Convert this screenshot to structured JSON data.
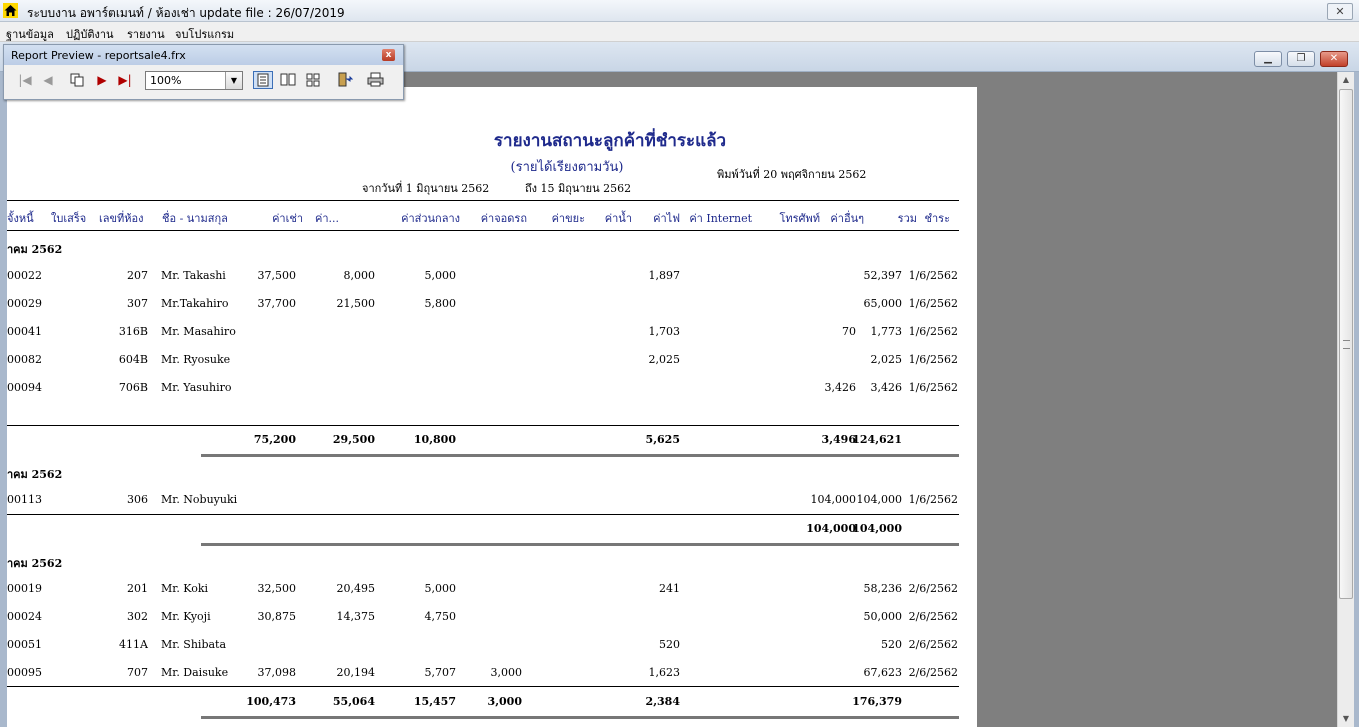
{
  "window": {
    "title": "ระบบงาน อพาร์ตเมนท์ / ห้องเช่า update file : 26/07/2019",
    "close_glyph": "✕"
  },
  "menu": [
    "ฐานข้อมูล",
    "ปฏิบัติงาน",
    "รายงาน",
    "จบโปรแกรม"
  ],
  "mdi_controls": {
    "minimize": "▁",
    "restore": "❐",
    "close": "✕"
  },
  "preview_toolbar": {
    "title": "Report Preview - reportsale4.frx",
    "zoom": "100%"
  },
  "report": {
    "title": "รายงานสถานะลูกค้าที่ชำระแล้ว",
    "subtitle": "(รายได้เรียงตามวัน)",
    "range_from": "จากวันที่  1 มิถุนายน 2562",
    "range_to": "ถึง   15 มิถุนายน 2562",
    "printed": "พิมพ์วันที่  20 พฤศจิกายน 2562",
    "columns": {
      "debt": "จั้งหนี้",
      "receipt": "ใบเสร็จ",
      "room": "เลขที่ห้อง",
      "name": "ชื่อ - นามสกุล",
      "rent": "ค่าเช่า",
      "c2": "ค่า...",
      "common": "ค่าส่วนกลาง",
      "parking": "ค่าจอดรถ",
      "garbage": "ค่าขยะ",
      "water": "ค่าน้ำ",
      "electric": "ค่าไฟ",
      "internet": "ค่า Internet",
      "phone": "โทรศัพท์",
      "other": "ค่าอื่นๆ",
      "total": "รวม",
      "paid": "ชำระ"
    },
    "groups": [
      {
        "header": "าคม  2562",
        "rows": [
          {
            "debt": "00022",
            "room": "207",
            "name": "Mr. Takashi",
            "rent": "37,500",
            "c2": "8,000",
            "common": "5,000",
            "parking": "",
            "electric": "1,897",
            "other": "",
            "total": "52,397",
            "paid": "1/6/2562"
          },
          {
            "debt": "00029",
            "room": "307",
            "name": "Mr.Takahiro",
            "rent": "37,700",
            "c2": "21,500",
            "common": "5,800",
            "parking": "",
            "electric": "",
            "other": "",
            "total": "65,000",
            "paid": "1/6/2562"
          },
          {
            "debt": "00041",
            "room": "316B",
            "name": "Mr. Masahiro",
            "rent": "",
            "c2": "",
            "common": "",
            "parking": "",
            "electric": "1,703",
            "other": "70",
            "total": "1,773",
            "paid": "1/6/2562"
          },
          {
            "debt": "00082",
            "room": "604B",
            "name": "Mr. Ryosuke",
            "rent": "",
            "c2": "",
            "common": "",
            "parking": "",
            "electric": "2,025",
            "other": "",
            "total": "2,025",
            "paid": "1/6/2562"
          },
          {
            "debt": "00094",
            "room": "706B",
            "name": "Mr. Yasuhiro",
            "rent": "",
            "c2": "",
            "common": "",
            "parking": "",
            "electric": "",
            "other": "3,426",
            "total": "3,426",
            "paid": "1/6/2562"
          }
        ],
        "subtotal": {
          "rent": "75,200",
          "c2": "29,500",
          "common": "10,800",
          "parking": "",
          "electric": "5,625",
          "other": "3,496",
          "total": "124,621"
        }
      },
      {
        "header": "าคม  2562",
        "rows": [
          {
            "debt": "00113",
            "room": "306",
            "name": "Mr. Nobuyuki",
            "rent": "",
            "c2": "",
            "common": "",
            "parking": "",
            "electric": "",
            "other": "104,000",
            "total": "104,000",
            "paid": "1/6/2562"
          }
        ],
        "subtotal": {
          "rent": "",
          "c2": "",
          "common": "",
          "parking": "",
          "electric": "",
          "other": "104,000",
          "total": "104,000"
        }
      },
      {
        "header": "าคม  2562",
        "rows": [
          {
            "debt": "00019",
            "room": "201",
            "name": "Mr. Koki",
            "rent": "32,500",
            "c2": "20,495",
            "common": "5,000",
            "parking": "",
            "electric": "241",
            "other": "",
            "total": "58,236",
            "paid": "2/6/2562"
          },
          {
            "debt": "00024",
            "room": "302",
            "name": "Mr. Kyoji",
            "rent": "30,875",
            "c2": "14,375",
            "common": "4,750",
            "parking": "",
            "electric": "",
            "other": "",
            "total": "50,000",
            "paid": "2/6/2562"
          },
          {
            "debt": "00051",
            "room": "411A",
            "name": "Mr. Shibata",
            "rent": "",
            "c2": "",
            "common": "",
            "parking": "",
            "electric": "520",
            "other": "",
            "total": "520",
            "paid": "2/6/2562"
          },
          {
            "debt": "00095",
            "room": "707",
            "name": "Mr. Daisuke",
            "rent": "37,098",
            "c2": "20,194",
            "common": "5,707",
            "parking": "3,000",
            "electric": "1,623",
            "other": "",
            "total": "67,623",
            "paid": "2/6/2562"
          }
        ],
        "subtotal": {
          "rent": "100,473",
          "c2": "55,064",
          "common": "15,457",
          "parking": "3,000",
          "electric": "2,384",
          "other": "",
          "total": "176,379"
        }
      }
    ]
  }
}
